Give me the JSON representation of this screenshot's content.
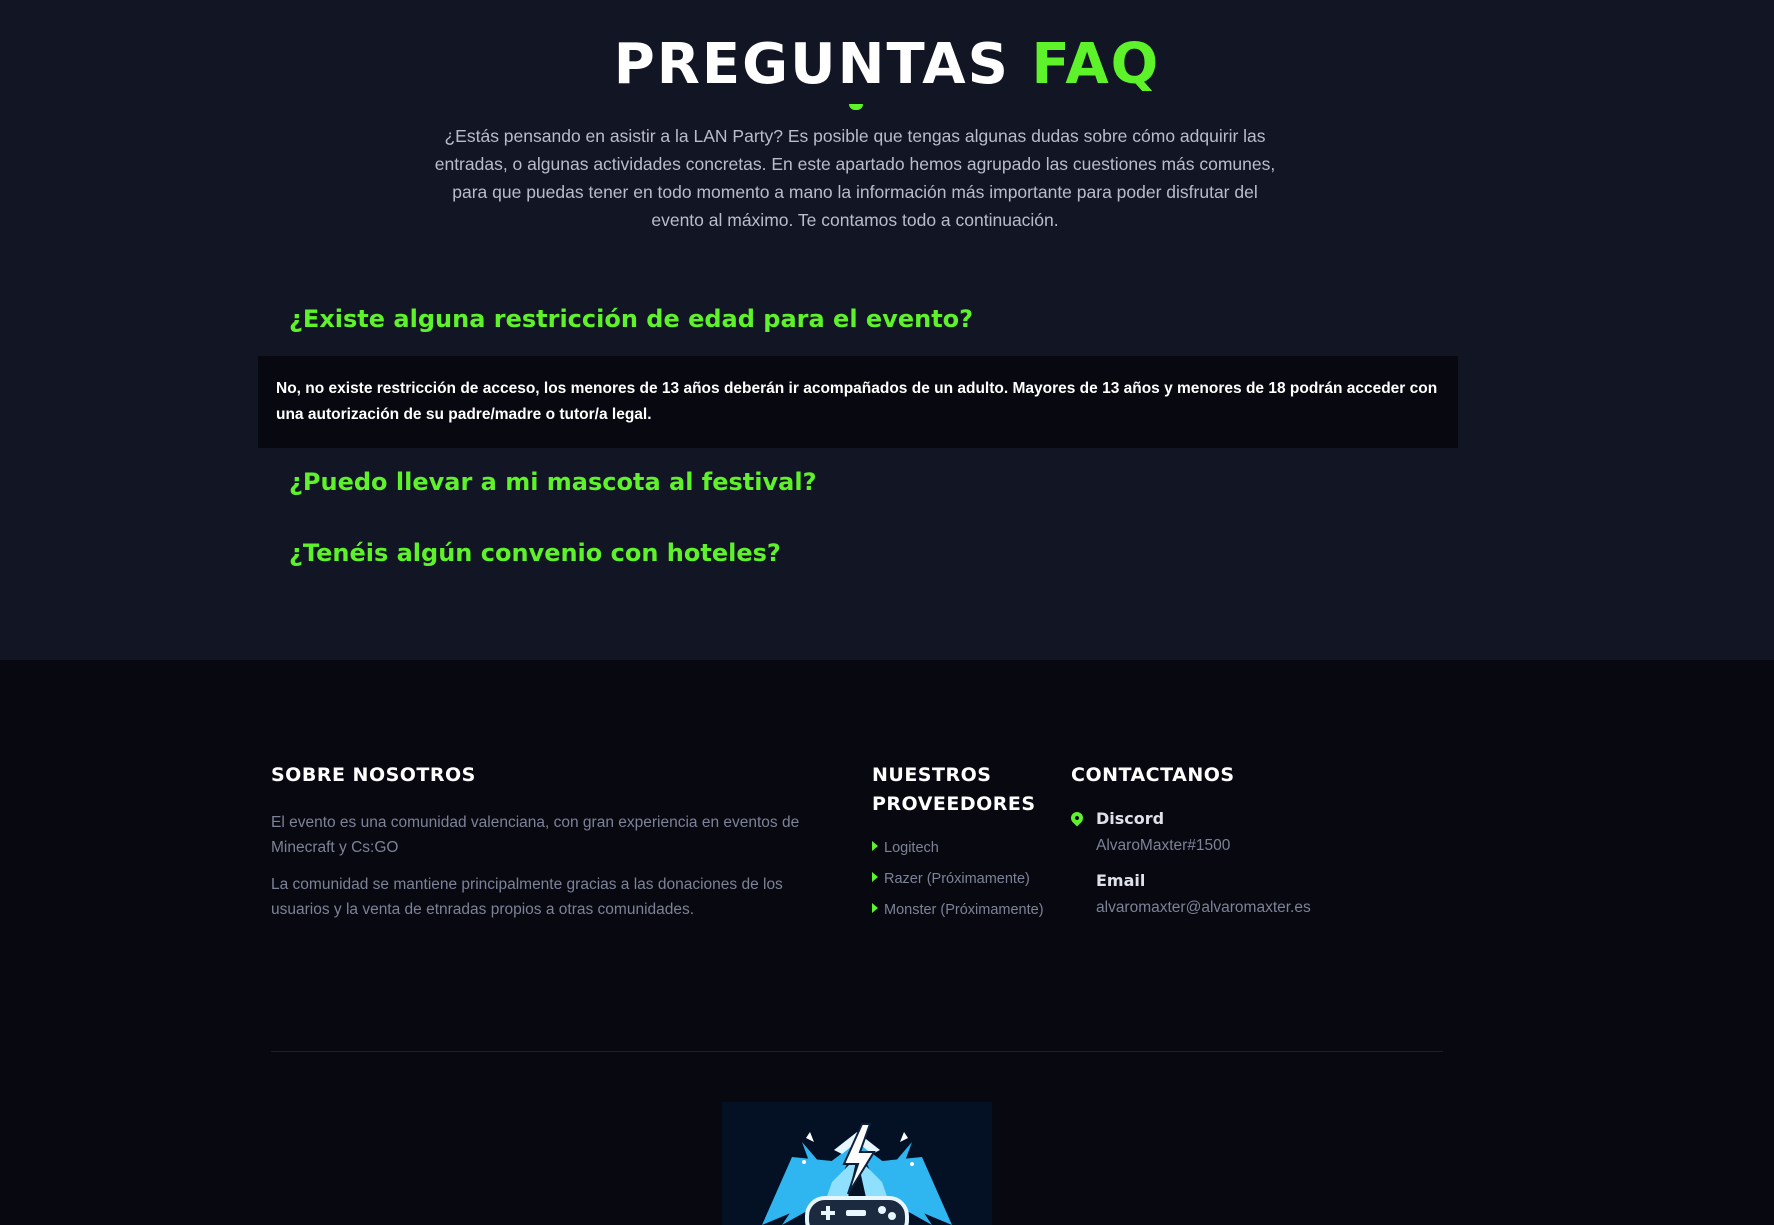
{
  "faq": {
    "title_white": "PREGUNTAS",
    "title_accent": "FAQ",
    "intro": "¿Estás pensando en asistir a la LAN Party? Es posible que tengas algunas dudas sobre cómo adquirir las entradas, o algunas actividades concretas. En este apartado hemos agrupado las cuestiones más comunes, para que puedas tener en todo momento a mano la información más importante para poder disfrutar del evento al máximo. Te contamos todo a continuación.",
    "items": [
      {
        "question": "¿Existe alguna restricción de edad para el evento?",
        "answer": "No, no existe restricción de acceso, los menores de 13 años deberán ir acompañados de un adulto. Mayores de 13 años y menores de 18 podrán acceder con una autorización de su padre/madre o tutor/a legal.",
        "expanded": true
      },
      {
        "question": "¿Puedo llevar a mi mascota al festival?",
        "expanded": false
      },
      {
        "question": "¿Tenéis algún convenio con hoteles?",
        "expanded": false
      }
    ]
  },
  "footer": {
    "about": {
      "title": "SOBRE NOSOTROS",
      "paragraphs": [
        "El evento es una comunidad valenciana, con gran experiencia en eventos de Minecraft y Cs:GO",
        "La comunidad se mantiene principalmente gracias a las donaciones de los usuarios y la venta de etnradas propios a otras comunidades."
      ]
    },
    "providers": {
      "title": "NUESTROS PROVEEDORES",
      "items": [
        "Logitech",
        "Razer (Próximamente)",
        "Monster (Próximamente)"
      ]
    },
    "contact": {
      "title": "CONTACTANOS",
      "discord_label": "Discord",
      "discord_value": "AlvaroMaxter#1500",
      "email_label": "Email",
      "email_value": "alvaromaxter@alvaromaxter.es"
    }
  },
  "icons": {
    "title_marker": "chevron-down-icon",
    "location": "map-pin-icon",
    "list_bullet": "caret-right-icon",
    "logo": "gamepad-lightning-logo"
  },
  "colors": {
    "accent": "#5ef22a",
    "section_bg": "#121524",
    "footer_bg": "#070810",
    "muted_text": "#7d8297"
  }
}
